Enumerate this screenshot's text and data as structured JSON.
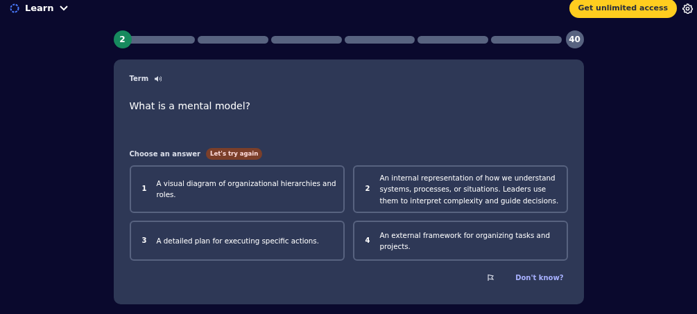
{
  "header": {
    "mode": "Learn",
    "cta": "Get unlimited access"
  },
  "progress": {
    "current": "2",
    "total": "40",
    "segments": [
      {
        "level": 0
      },
      {
        "level": 0
      },
      {
        "level": 0
      },
      {
        "level": 0
      },
      {
        "level": 0
      },
      {
        "level": 0
      }
    ]
  },
  "card": {
    "label": "Term",
    "question": "What is a mental model?",
    "prompt": "Choose an answer",
    "badge": "Let's try again",
    "answers": [
      {
        "number": "1",
        "text": "A visual diagram of organizational hierarchies and roles.",
        "selected": false
      },
      {
        "number": "2",
        "text": "An internal representation of how we understand systems, processes, or situations. Leaders use them to interpret complexity and guide decisions.",
        "selected": false
      },
      {
        "number": "3",
        "text": "A detailed plan for executing specific actions.",
        "selected": false
      },
      {
        "number": "4",
        "text": "An external framework for organizing tasks and projects.",
        "selected": false
      }
    ],
    "dont_know": "Don't know?"
  }
}
